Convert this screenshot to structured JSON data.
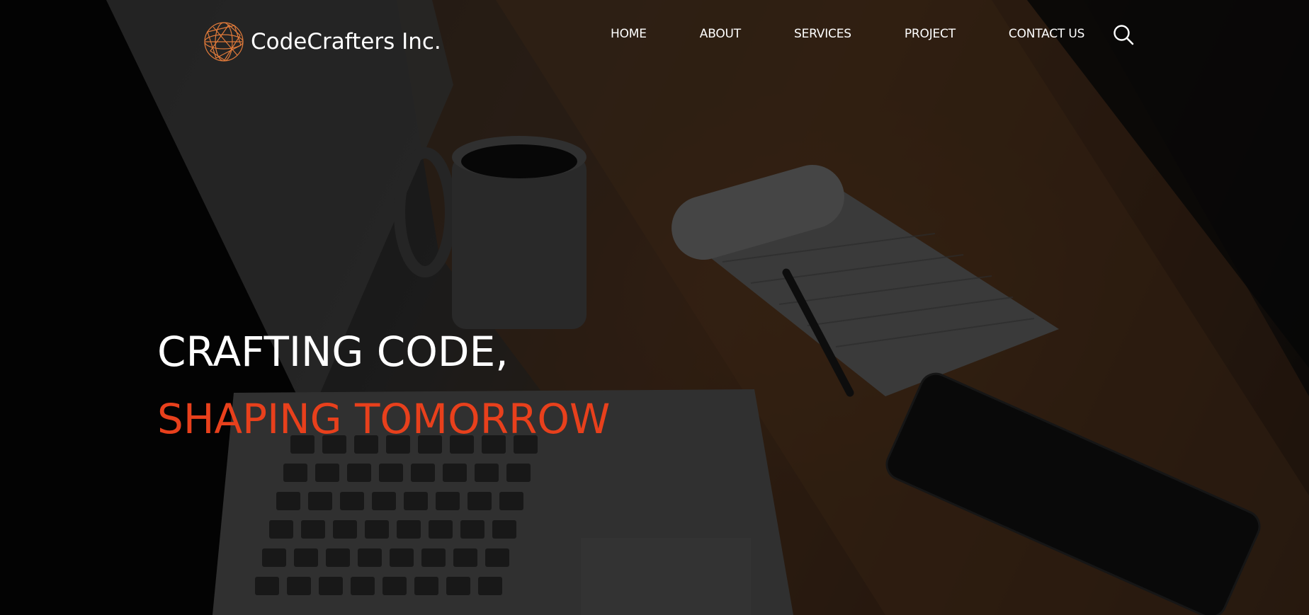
{
  "brand": {
    "name": "CodeCrafters Inc.",
    "logo_icon": "globe-wireframe-icon",
    "accent_color": "#e07a3a"
  },
  "nav": {
    "items": [
      {
        "label": "HOME"
      },
      {
        "label": "ABOUT"
      },
      {
        "label": "SERVICES"
      },
      {
        "label": "PROJECT"
      },
      {
        "label": "CONTACT US"
      }
    ],
    "search_icon": "search-icon"
  },
  "hero": {
    "line1": "CRAFTING CODE,",
    "line2": "SHAPING TOMORROW",
    "line2_color": "#e8401c",
    "background": "desk-with-laptop-coffee-notepad-phone-photo"
  }
}
